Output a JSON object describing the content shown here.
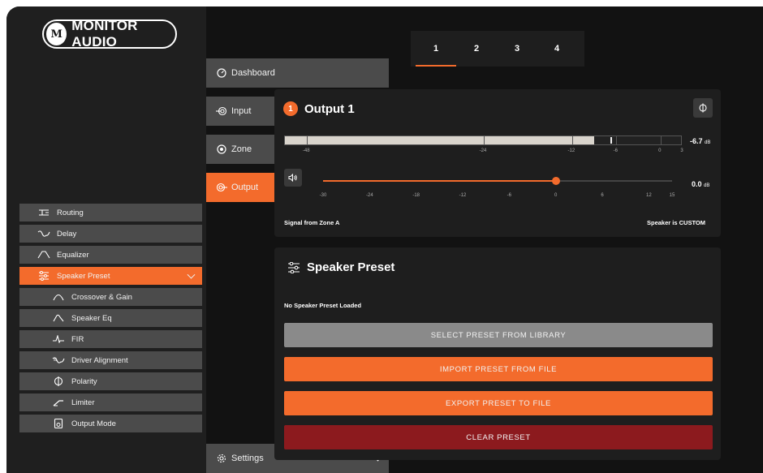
{
  "brand": {
    "logo_text": "MONITOR AUDIO",
    "logo_mark": "M"
  },
  "sidebar": {
    "dashboard": "Dashboard",
    "input": "Input",
    "zone": "Zone",
    "output": "Output",
    "routing": "Routing",
    "delay": "Delay",
    "equalizer": "Equalizer",
    "speaker_preset": "Speaker Preset",
    "crossover_gain": "Crossover & Gain",
    "speaker_eq": "Speaker Eq",
    "fir": "FIR",
    "driver_alignment": "Driver Alignment",
    "polarity": "Polarity",
    "limiter": "Limiter",
    "output_mode": "Output Mode",
    "settings": "Settings"
  },
  "tabs": [
    "1",
    "2",
    "3",
    "4"
  ],
  "active_tab": "1",
  "output_card": {
    "badge": "1",
    "title": "Output 1",
    "meter": {
      "level_db": -6.7,
      "value": "-6.7",
      "unit": "dB",
      "scale": [
        "-48",
        "-24",
        "-12",
        "-6",
        "0",
        "3"
      ],
      "scale_values": [
        -48,
        -24,
        -12,
        -6,
        0,
        3
      ],
      "fill_db": -9,
      "peak_db": -6.7,
      "range": [
        -51,
        3
      ]
    },
    "gain": {
      "value": "0.0",
      "unit": "dB",
      "level_db": 0,
      "scale": [
        "-30",
        "-24",
        "-18",
        "-12",
        "-6",
        "0",
        "6",
        "12",
        "15"
      ],
      "scale_values": [
        -30,
        -24,
        -18,
        -12,
        -6,
        0,
        6,
        12,
        15
      ],
      "range": [
        -30,
        15
      ]
    },
    "signal_text": "Signal from Zone A",
    "speaker_text": "Speaker is CUSTOM"
  },
  "preset_card": {
    "title": "Speaker Preset",
    "status": "No Speaker Preset Loaded",
    "select_btn": "SELECT PRESET FROM LIBRARY",
    "import_btn": "IMPORT PRESET FROM FILE",
    "export_btn": "EXPORT PRESET TO FILE",
    "clear_btn": "CLEAR PRESET"
  },
  "colors": {
    "accent": "#f36b2c",
    "danger": "#8c1a1e",
    "disabled": "#8a8a8a",
    "nav": "#4b4b4b"
  }
}
